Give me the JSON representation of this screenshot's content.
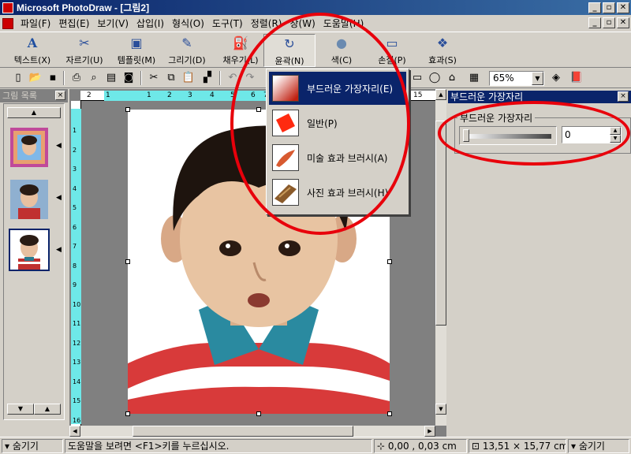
{
  "titlebar": {
    "title": "Microsoft PhotoDraw - [그림2]",
    "minimize": "_",
    "maximize": "▫",
    "close": "✕"
  },
  "menubar": {
    "items": [
      "파일(F)",
      "편집(E)",
      "보기(V)",
      "삽입(I)",
      "형식(O)",
      "도구(T)",
      "정렬(R)",
      "창(W)",
      "도움말(H)"
    ]
  },
  "visual_toolbar": {
    "buttons": [
      {
        "label": "텍스트(X)",
        "icon": "text-icon"
      },
      {
        "label": "자르기(U)",
        "icon": "scissors-icon"
      },
      {
        "label": "템플릿(M)",
        "icon": "template-icon"
      },
      {
        "label": "그리기(D)",
        "icon": "pen-icon"
      },
      {
        "label": "채우기(L)",
        "icon": "paint-bucket-icon"
      },
      {
        "label": "윤곽(N)",
        "icon": "outline-icon"
      },
      {
        "label": "색(C)",
        "icon": "color-icon"
      },
      {
        "label": "손질(P)",
        "icon": "touchup-icon"
      },
      {
        "label": "효과(S)",
        "icon": "effects-icon"
      }
    ]
  },
  "standard_toolbar": {
    "zoom": "65%"
  },
  "left_panel": {
    "title": "그림 목록",
    "close": "×",
    "thumbnail_count": 3,
    "selected_index": 2
  },
  "outline_menu": {
    "items": [
      {
        "label": "부드러운 가장자리(E)",
        "highlighted": true
      },
      {
        "label": "일반(P)",
        "highlighted": false
      },
      {
        "label": "미술 효과 브러시(A)",
        "highlighted": false
      },
      {
        "label": "사진 효과 브러시(H)",
        "highlighted": false
      }
    ]
  },
  "right_panel": {
    "title": "부드러운 가장자리",
    "close": "×",
    "group_label": "부드러운 가장자리",
    "slider_value": 0,
    "spin_value": "0"
  },
  "rulers": {
    "h_labels": [
      "2",
      "1",
      "1",
      "2",
      "3",
      "4",
      "5",
      "6",
      "7",
      "15"
    ],
    "v_labels": [
      "1",
      "2",
      "3",
      "4",
      "5",
      "6",
      "7",
      "8",
      "9",
      "10",
      "11",
      "12",
      "13",
      "14",
      "15",
      "16"
    ]
  },
  "statusbar": {
    "hide_left": "숨기기",
    "help_text": "도움말을 보려면 <F1>키를 누르십시오.",
    "position": "0,00 , 0,03 cm",
    "size": "13,51 × 15,77 cm",
    "hide_right": "숨기기"
  },
  "colors": {
    "title_active": "#0a246a",
    "annotation_red": "#e8000b",
    "ruler_cyan": "#6ee8e8",
    "face": "#d4d0c8"
  }
}
